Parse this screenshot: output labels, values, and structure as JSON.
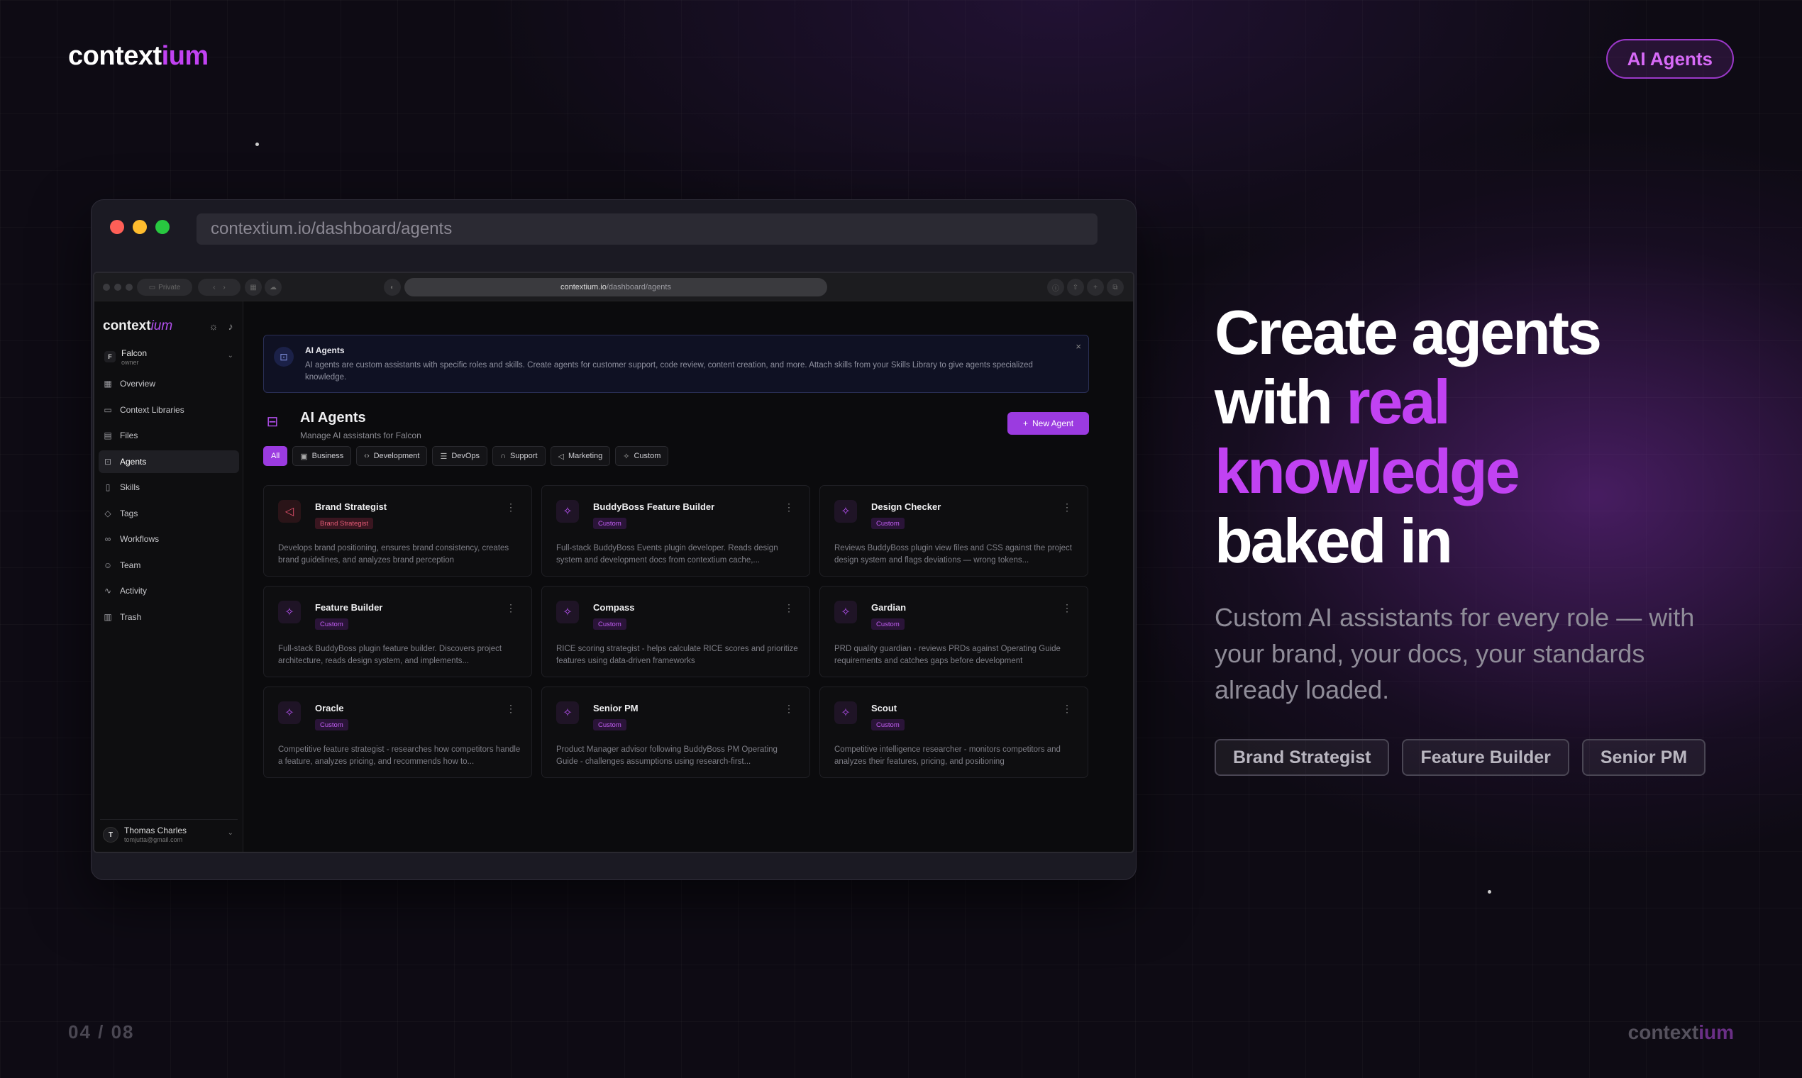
{
  "brand": {
    "name_main": "context",
    "name_accent": "ium"
  },
  "topPill": "AI Agents",
  "pager": "04 / 08",
  "hero": {
    "line1": "Create agents",
    "line2a": "with ",
    "line2b": "real",
    "line3": "knowledge",
    "line4": "baked in"
  },
  "subtitle": "Custom AI assistants for every role — with your brand, your docs, your standards already loaded.",
  "tags": [
    "Brand Strategist",
    "Feature Builder",
    "Senior PM"
  ],
  "browser": {
    "url": "contextium.io/dashboard/agents"
  },
  "inner": {
    "private_label": "Private",
    "url_host": "contextium.io",
    "url_path": "/dashboard/agents",
    "sidebar": {
      "workspace": {
        "initial": "F",
        "name": "Falcon",
        "role": "owner"
      },
      "nav": [
        {
          "label": "Overview",
          "icon": "grid-icon"
        },
        {
          "label": "Context Libraries",
          "icon": "folder-icon"
        },
        {
          "label": "Files",
          "icon": "file-icon"
        },
        {
          "label": "Agents",
          "icon": "bot-icon",
          "active": true
        },
        {
          "label": "Skills",
          "icon": "book-icon"
        },
        {
          "label": "Tags",
          "icon": "tag-icon"
        },
        {
          "label": "Workflows",
          "icon": "workflow-icon"
        },
        {
          "label": "Team",
          "icon": "users-icon"
        },
        {
          "label": "Activity",
          "icon": "activity-icon"
        },
        {
          "label": "Trash",
          "icon": "trash-icon"
        }
      ],
      "user": {
        "initial": "T",
        "name": "Thomas Charles",
        "email": "tomjutta@gmail.com"
      }
    },
    "info": {
      "title": "AI Agents",
      "text": "AI agents are custom assistants with specific roles and skills. Create agents for customer support, code review, content creation, and more. Attach skills from your Skills Library to give agents specialized knowledge."
    },
    "page": {
      "title": "AI Agents",
      "subtitle": "Manage AI assistants for Falcon",
      "new_button": "New Agent"
    },
    "filters": [
      "All",
      "Business",
      "Development",
      "DevOps",
      "Support",
      "Marketing",
      "Custom"
    ],
    "agents": [
      {
        "name": "Brand Strategist",
        "badge": "Brand Strategist",
        "desc": "Develops brand positioning, ensures brand consistency, creates brand guidelines, and analyzes brand perception"
      },
      {
        "name": "BuddyBoss Feature Builder",
        "badge": "Custom",
        "desc": "Full-stack BuddyBoss Events plugin developer. Reads design system and development docs from contextium cache,..."
      },
      {
        "name": "Design Checker",
        "badge": "Custom",
        "desc": "Reviews BuddyBoss plugin view files and CSS against the project design system and flags deviations — wrong tokens..."
      },
      {
        "name": "Feature Builder",
        "badge": "Custom",
        "desc": "Full-stack BuddyBoss plugin feature builder. Discovers project architecture, reads design system, and implements..."
      },
      {
        "name": "Compass",
        "badge": "Custom",
        "desc": "RICE scoring strategist - helps calculate RICE scores and prioritize features using data-driven frameworks"
      },
      {
        "name": "Gardian",
        "badge": "Custom",
        "desc": "PRD quality guardian - reviews PRDs against Operating Guide requirements and catches gaps before development"
      },
      {
        "name": "Oracle",
        "badge": "Custom",
        "desc": "Competitive feature strategist - researches how competitors handle a feature, analyzes pricing, and recommends how to..."
      },
      {
        "name": "Senior PM",
        "badge": "Custom",
        "desc": "Product Manager advisor following BuddyBoss PM Operating Guide - challenges assumptions using research-first..."
      },
      {
        "name": "Scout",
        "badge": "Custom",
        "desc": "Competitive intelligence researcher - monitors competitors and analyzes their features, pricing, and positioning"
      }
    ]
  },
  "colors": {
    "accent": "#c142f2",
    "button": "#9b3be0",
    "bg": "#0e0b14"
  }
}
